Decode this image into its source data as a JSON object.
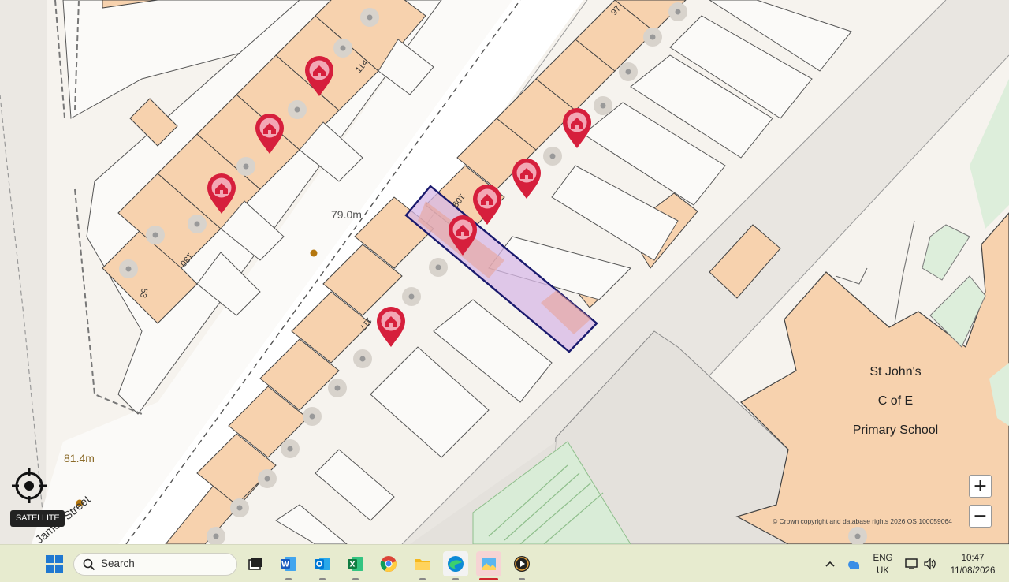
{
  "map": {
    "spot_heights": [
      "79.0m",
      "81.4m"
    ],
    "street_name": "James   Street",
    "house_numbers": [
      "97",
      "114",
      "109",
      "130",
      "53",
      "117"
    ],
    "school_label": [
      "St John's",
      "C of E",
      "Primary School"
    ],
    "copyright": "© Crown copyright and database rights 2026 OS 100059064",
    "pin_color": "#d61f3c",
    "highlight_fill": "#d7b8e6",
    "highlight_stroke": "#1a1a6e",
    "building_fill": "#f7d2ae"
  },
  "controls": {
    "satellite_label": "SATELLITE",
    "zoom_in": "+",
    "zoom_out": "−",
    "locate_icon": "crosshair-icon"
  },
  "taskbar": {
    "search_placeholder": "Search",
    "language": "ENG",
    "region": "UK",
    "time": "10:47",
    "date": "11/08/2026",
    "apps": [
      "start-icon",
      "task-view-icon",
      "word-icon",
      "outlook-icon",
      "excel-icon",
      "chrome-icon",
      "file-explorer-icon",
      "edge-icon",
      "photos-icon",
      "media-player-icon"
    ]
  }
}
